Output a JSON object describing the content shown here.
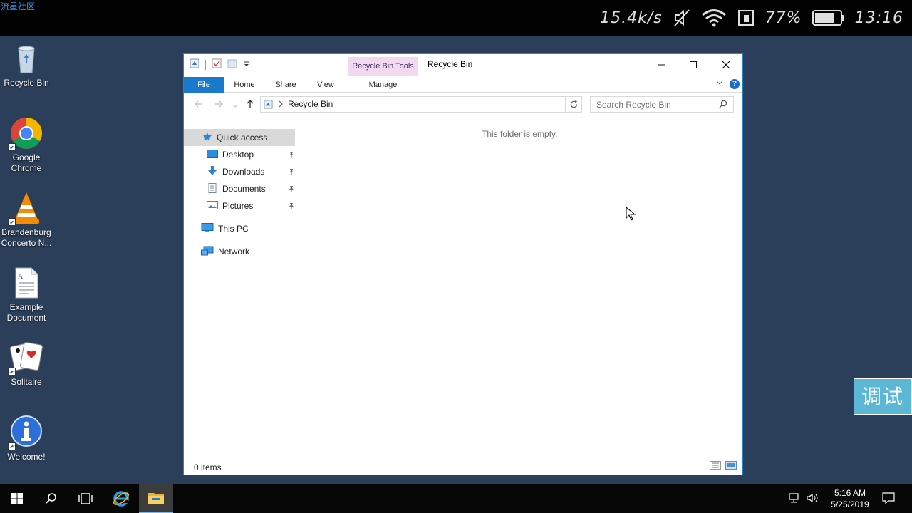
{
  "status_bar": {
    "app_tag": "流星社区",
    "speed": "15.4k/s",
    "battery": "77%",
    "time": "13:16"
  },
  "desktop": {
    "icons": [
      {
        "label": "Recycle Bin",
        "icon": "recycle-bin-icon"
      },
      {
        "label": "Google Chrome",
        "icon": "chrome-icon"
      },
      {
        "label": "Brandenburg Concerto N...",
        "icon": "vlc-icon"
      },
      {
        "label": "Example Document",
        "icon": "document-icon"
      },
      {
        "label": "Solitaire",
        "icon": "solitaire-icon"
      },
      {
        "label": "Welcome!",
        "icon": "info-icon"
      }
    ]
  },
  "explorer": {
    "title": "Recycle Bin",
    "contextual_tab": "Recycle Bin Tools",
    "ribbon_tabs": {
      "file": "File",
      "home": "Home",
      "share": "Share",
      "view": "View",
      "manage": "Manage"
    },
    "help": "?",
    "address": "Recycle Bin",
    "search_placeholder": "Search Recycle Bin",
    "nav": {
      "quick_access": "Quick access",
      "desktop": "Desktop",
      "downloads": "Downloads",
      "documents": "Documents",
      "pictures": "Pictures",
      "this_pc": "This PC",
      "network": "Network"
    },
    "empty_message": "This folder is empty.",
    "status": "0 items"
  },
  "floating_button": "调试",
  "taskbar": {
    "time": "5:16 AM",
    "date": "5/25/2019"
  },
  "colors": {
    "desktop_bg": "#2b3f5b",
    "accent": "#1979ca",
    "contextual_tab": "#f3d9f0",
    "float_button": "#5bb7d4"
  }
}
